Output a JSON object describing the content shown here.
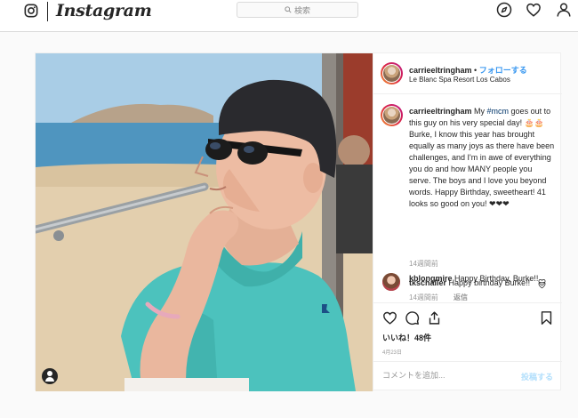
{
  "nav": {
    "logo_icon": "instagram-glyph-icon",
    "wordmark": "Instagram",
    "search_placeholder": "検索",
    "icons": [
      "compass-icon",
      "heart-icon",
      "profile-icon"
    ]
  },
  "post": {
    "header": {
      "username": "carrieeltringham",
      "dot": "•",
      "follow_label": "フォローする",
      "location": "Le Blanc Spa Resort Los Cabos"
    },
    "caption": {
      "username": "carrieeltringham",
      "pre": "My ",
      "hashtag": "#mcm",
      "text": " goes out to this guy on his very special day! 🎂🎂 Burke, I know this year has brought equally as many joys as there have been challenges, and I'm in awe of everything you do and how MANY people you serve. The boys and I love you beyond words. Happy Birthday, sweetheart! 41 looks so good on you! ❤❤❤",
      "time": "14週間前"
    },
    "comments": [
      {
        "username": "tkschaller",
        "text": "Happy birthday Burke!!",
        "time": "14週間前",
        "reply_label": "返信"
      },
      {
        "username": "kblongmire",
        "text": "Happy Birthday, Burke!!"
      }
    ],
    "likes": "いいね！48件",
    "date": "4月23日",
    "add_comment_placeholder": "コメントを追加...",
    "post_button": "投稿する",
    "colors": {
      "link": "#3897f0",
      "hashtag": "#003569",
      "post_disabled": "#b2dffc"
    }
  }
}
